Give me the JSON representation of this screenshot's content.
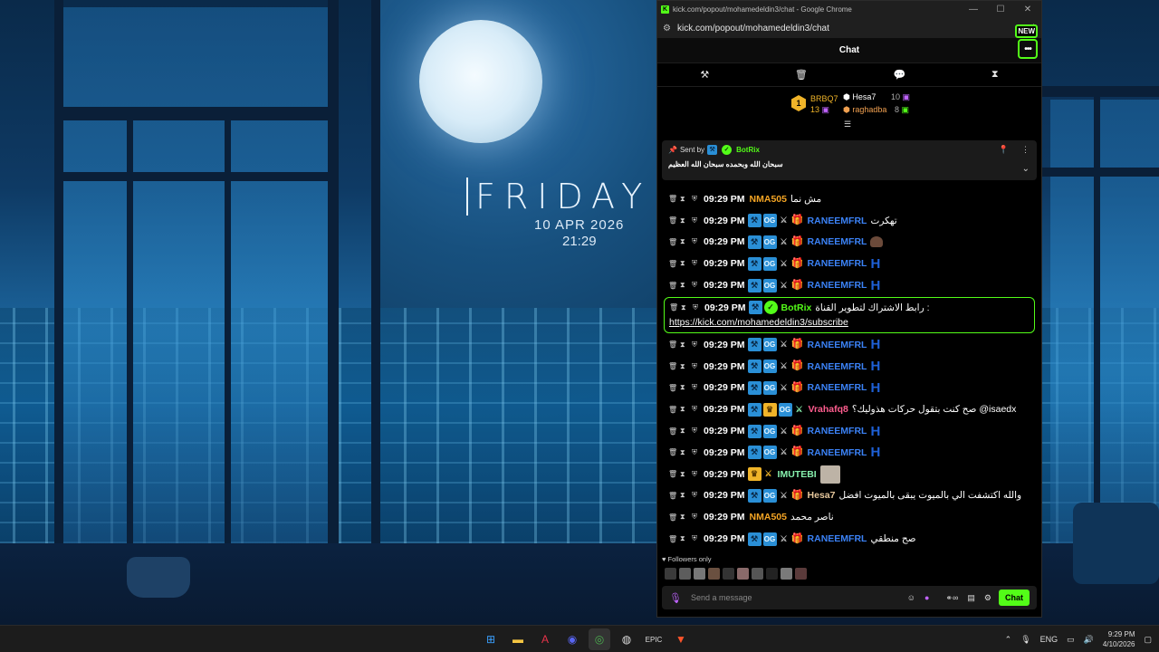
{
  "desktop": {
    "day": "FRIDAY",
    "date": "10 APR 2026",
    "time": "21:29"
  },
  "browser": {
    "title": "kick.com/popout/mohamedeldin3/chat - Google Chrome",
    "url": "kick.com/popout/mohamedeldin3/chat"
  },
  "chat": {
    "header": "Chat",
    "new_badge": "NEW",
    "leaderboard": {
      "first": {
        "rank": "1",
        "name": "BRBQ7",
        "count": "13"
      },
      "second": {
        "name": "Hesa7",
        "count": "10"
      },
      "third": {
        "name": "raghadba",
        "count": "8"
      }
    },
    "pinned": {
      "sent_by": "Sent by",
      "bot": "BotRix",
      "message": "سبحان الله وبحمده سبحان الله العظيم"
    },
    "messages": [
      {
        "time": "09:29 PM",
        "user": "NMA505",
        "color": "u-orange",
        "badges": "",
        "text": "مش نما"
      },
      {
        "time": "09:29 PM",
        "user": "RANEEMFRL",
        "color": "u-blue",
        "badges": "mod-og-sword-gift",
        "text": "تهكرت"
      },
      {
        "time": "09:29 PM",
        "user": "RANEEMFRL",
        "color": "u-blue",
        "badges": "mod-og-sword-gift",
        "text": ""
      },
      {
        "time": "09:29 PM",
        "user": "RANEEMFRL",
        "color": "u-blue",
        "badges": "mod-og-sword-gift",
        "text": "H"
      },
      {
        "time": "09:29 PM",
        "user": "RANEEMFRL",
        "color": "u-blue",
        "badges": "mod-og-sword-gift",
        "text": "H"
      }
    ],
    "bot_message": {
      "time": "09:29 PM",
      "user": "BotRix",
      "text": "رابط الاشتراك لتطوير القناة :",
      "link": "https://kick.com/mohamedeldin3/subscribe"
    },
    "messages2": [
      {
        "time": "09:29 PM",
        "user": "RANEEMFRL",
        "text": "H"
      },
      {
        "time": "09:29 PM",
        "user": "RANEEMFRL",
        "text": "H"
      },
      {
        "time": "09:29 PM",
        "user": "RANEEMFRL",
        "text": "H"
      },
      {
        "time": "09:29 PM",
        "user": "Vrahafq8",
        "text": "صح كنت بتقول حركات هذوليك؟ @isaedx"
      },
      {
        "time": "09:29 PM",
        "user": "RANEEMFRL",
        "text": "H"
      },
      {
        "time": "09:29 PM",
        "user": "RANEEMFRL",
        "text": "H"
      },
      {
        "time": "09:29 PM",
        "user": "IMUTEBI",
        "text": ""
      },
      {
        "time": "09:29 PM",
        "user": "Hesa7",
        "text": "والله اكتشفت الي بالميوت يبقى بالميوت افضل"
      },
      {
        "time": "09:29 PM",
        "user": "NMA505",
        "text": "ناصر محمد"
      },
      {
        "time": "09:29 PM",
        "user": "RANEEMFRL",
        "text": "صح منطقي"
      }
    ],
    "followers_only": "Followers only",
    "composer_placeholder": "Send a message",
    "chat_button": "Chat"
  },
  "taskbar": {
    "lang": "ENG",
    "time": "9:29 PM",
    "date": "4/10/2026"
  }
}
